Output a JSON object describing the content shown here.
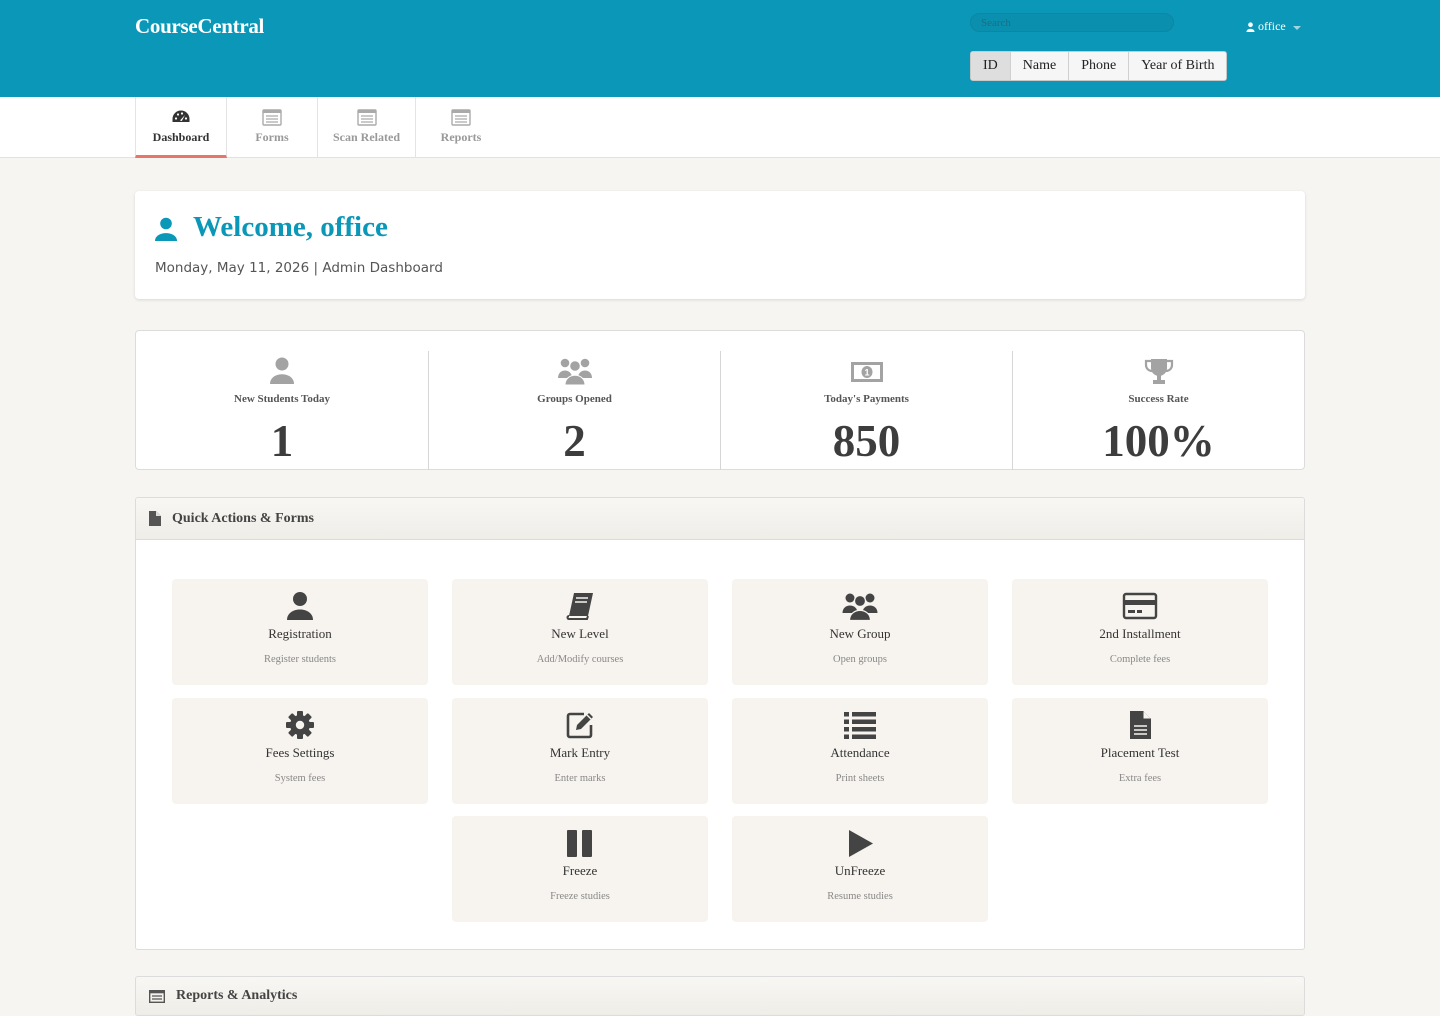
{
  "app": {
    "brand": "CourseCentral"
  },
  "header": {
    "search_placeholder": "Search",
    "user_name": "office",
    "search_modes": [
      "ID",
      "Name",
      "Phone",
      "Year of Birth"
    ],
    "active_mode": "ID"
  },
  "nav": {
    "tabs": [
      {
        "label": "Dashboard",
        "icon": "dashboard-icon",
        "active": true
      },
      {
        "label": "Forms",
        "icon": "list-window-icon"
      },
      {
        "label": "Scan Related",
        "icon": "list-window-icon"
      },
      {
        "label": "Reports",
        "icon": "list-window-icon"
      }
    ]
  },
  "welcome": {
    "title": "Welcome, office",
    "subtitle": "Monday, May 11, 2026 | Admin Dashboard"
  },
  "stats": [
    {
      "label": "New Students Today",
      "value": "1",
      "icon": "user-icon"
    },
    {
      "label": "Groups Opened",
      "value": "2",
      "icon": "users-icon"
    },
    {
      "label": "Today's Payments",
      "value": "850",
      "icon": "money-icon"
    },
    {
      "label": "Success Rate",
      "value": "100%",
      "icon": "trophy-icon"
    }
  ],
  "quick_actions": {
    "title": "Quick Actions & Forms",
    "items": [
      {
        "label": "Registration",
        "desc": "Register students",
        "icon": "user-icon"
      },
      {
        "label": "New Level",
        "desc": "Add/Modify courses",
        "icon": "book-icon"
      },
      {
        "label": "New Group",
        "desc": "Open groups",
        "icon": "users-icon"
      },
      {
        "label": "2nd Installment",
        "desc": "Complete fees",
        "icon": "credit-card-icon"
      },
      {
        "label": "Fees Settings",
        "desc": "System fees",
        "icon": "gear-icon"
      },
      {
        "label": "Mark Entry",
        "desc": "Enter marks",
        "icon": "edit-icon"
      },
      {
        "label": "Attendance",
        "desc": "Print sheets",
        "icon": "list-icon"
      },
      {
        "label": "Placement Test",
        "desc": "Extra fees",
        "icon": "file-icon"
      },
      {
        "label": "Freeze",
        "desc": "Freeze studies",
        "icon": "pause-icon"
      },
      {
        "label": "UnFreeze",
        "desc": "Resume studies",
        "icon": "play-icon"
      }
    ]
  },
  "reports_panel": {
    "title": "Reports & Analytics"
  }
}
